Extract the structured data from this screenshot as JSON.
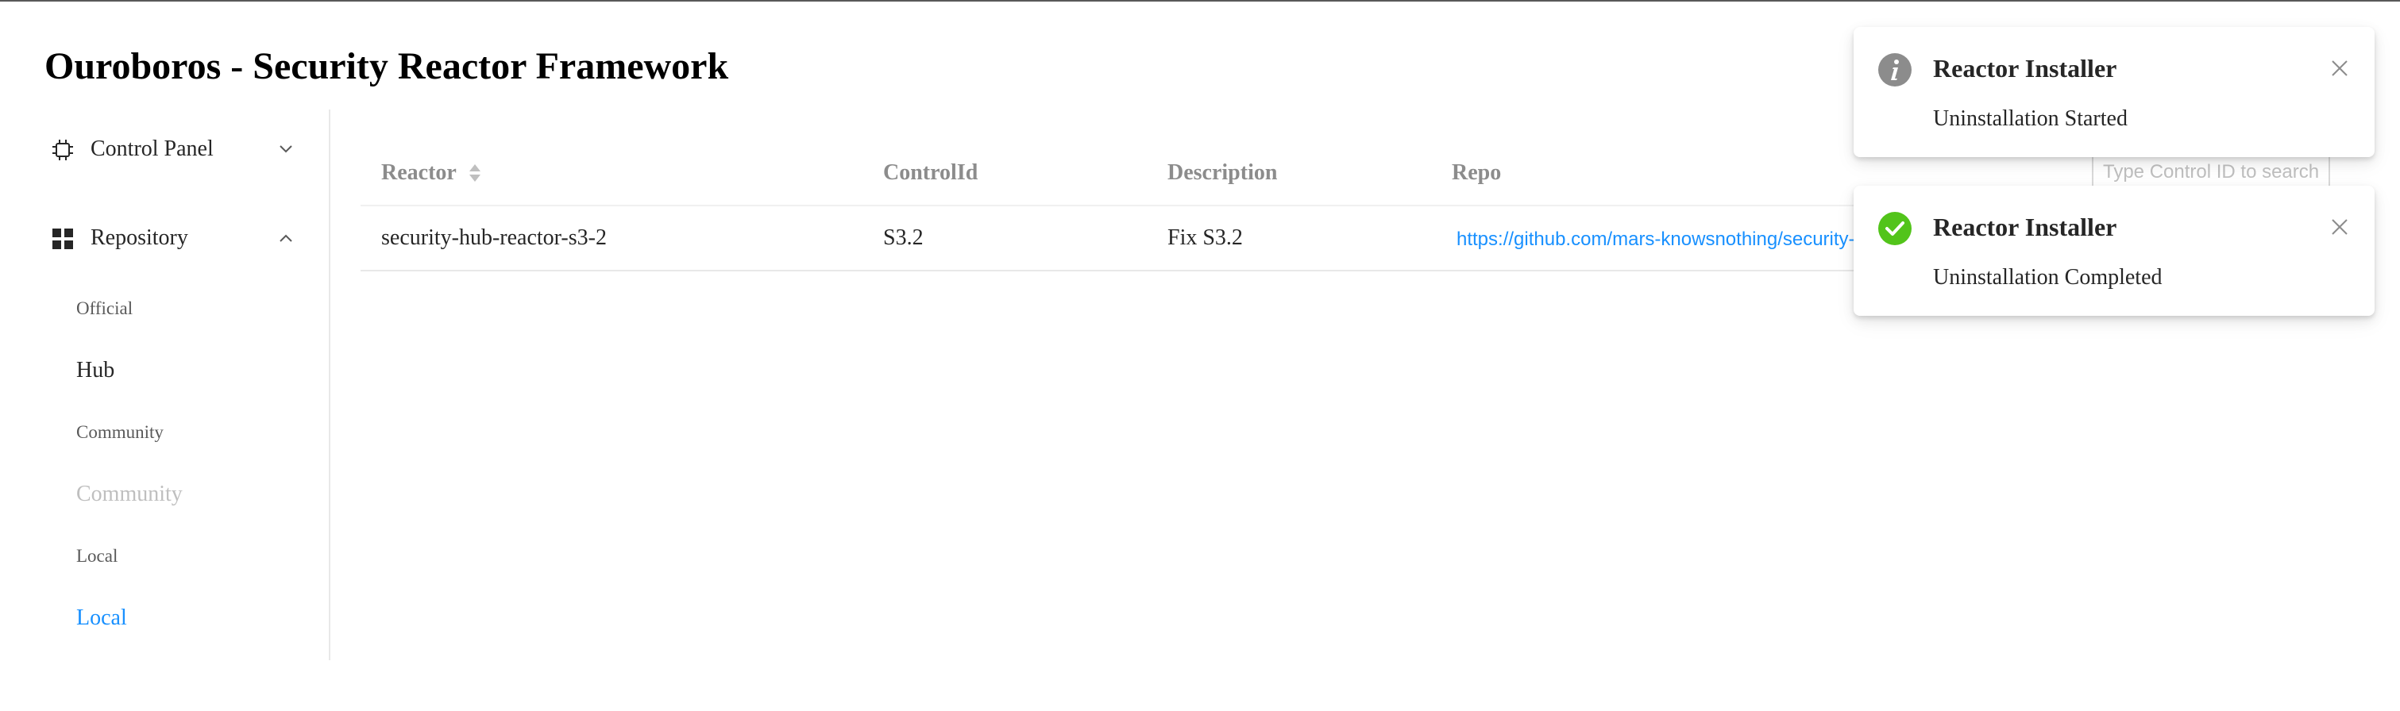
{
  "app": {
    "title": "Ouroboros - Security Reactor Framework"
  },
  "sidebar": {
    "groups": [
      {
        "label": "Control Panel",
        "icon": "chip-icon",
        "expanded": false
      },
      {
        "label": "Repository",
        "icon": "grid-icon",
        "expanded": true
      }
    ],
    "items": [
      {
        "label": "Official",
        "style": "small"
      },
      {
        "label": "Hub",
        "style": "normal"
      },
      {
        "label": "Community",
        "style": "small"
      },
      {
        "label": "Community",
        "style": "muted"
      },
      {
        "label": "Local",
        "style": "small"
      },
      {
        "label": "Local",
        "style": "active"
      }
    ]
  },
  "table": {
    "columns": [
      "Reactor",
      "ControlId",
      "Description",
      "Repo"
    ],
    "sortable_column": "Reactor",
    "search": {
      "placeholder": "Type Control ID to search"
    },
    "rows": [
      {
        "reactor": "security-hub-reactor-s3-2",
        "control_id": "S3.2",
        "description": "Fix S3.2",
        "repo": "https://github.com/mars-knowsnothing/security-"
      }
    ]
  },
  "notifications": [
    {
      "type": "info",
      "icon": "info-icon",
      "title": "Reactor Installer",
      "message": "Uninstallation Started"
    },
    {
      "type": "success",
      "icon": "check-circle-icon",
      "title": "Reactor Installer",
      "message": "Uninstallation Completed"
    }
  ],
  "colors": {
    "accent": "#1890ff",
    "success": "#52c41a",
    "info_icon": "#8c8c8c",
    "header_text": "#8c8c8c",
    "divider": "#e8e8e8"
  }
}
